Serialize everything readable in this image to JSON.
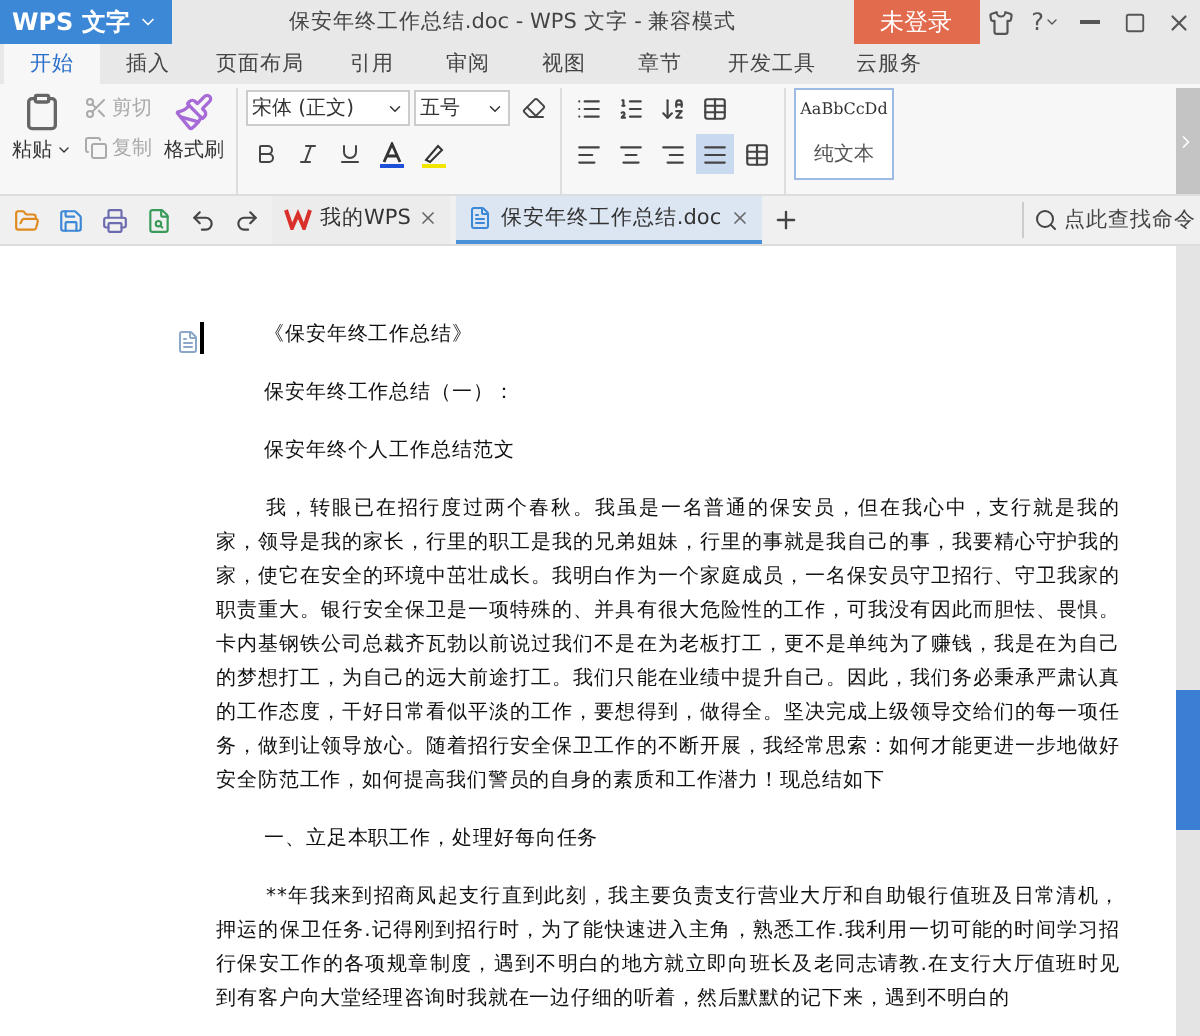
{
  "app_button": {
    "label": "WPS 文字"
  },
  "window": {
    "title": "保安年终工作总结.doc - WPS 文字 - 兼容模式"
  },
  "login_button": {
    "label": "未登录"
  },
  "help": {
    "label": "?"
  },
  "ribbon_tabs": [
    {
      "label": "开始",
      "selected": true
    },
    {
      "label": "插入",
      "selected": false
    },
    {
      "label": "页面布局",
      "selected": false
    },
    {
      "label": "引用",
      "selected": false
    },
    {
      "label": "审阅",
      "selected": false
    },
    {
      "label": "视图",
      "selected": false
    },
    {
      "label": "章节",
      "selected": false
    },
    {
      "label": "开发工具",
      "selected": false
    },
    {
      "label": "云服务",
      "selected": false
    }
  ],
  "clipboard": {
    "paste": "粘贴",
    "cut": {
      "label": "剪切",
      "disabled": true
    },
    "copy": {
      "label": "复制",
      "disabled": true
    },
    "format_painter": "格式刷"
  },
  "font": {
    "family": "宋体 (正文)",
    "size": "五号"
  },
  "alignment": [
    {
      "kind": "left",
      "selected": false
    },
    {
      "kind": "center",
      "selected": false
    },
    {
      "kind": "right",
      "selected": false
    },
    {
      "kind": "justify",
      "selected": true
    },
    {
      "kind": "distributed",
      "selected": false
    }
  ],
  "style_gallery": {
    "sample": "AaBbCcDd",
    "name": "纯文本"
  },
  "doc_tabs": [
    {
      "label": "我的WPS",
      "kind": "home",
      "selected": false
    },
    {
      "label": "保安年终工作总结.doc",
      "kind": "doc",
      "selected": true
    }
  ],
  "command_search": {
    "placeholder": "点此查找命令"
  },
  "document": {
    "paragraphs": [
      {
        "kind": "heading",
        "text": "《保安年终工作总结》"
      },
      {
        "kind": "heading",
        "text": "保安年终工作总结（一）："
      },
      {
        "kind": "heading",
        "text": "保安年终个人工作总结范文"
      },
      {
        "kind": "body",
        "text": "我，转眼已在招行度过两个春秋。我虽是一名普通的保安员，但在我心中，支行就是我的家，领导是我的家长，行里的职工是我的兄弟姐妹，行里的事就是我自己的事，我要精心守护我的家，使它在安全的环境中茁壮成长。我明白作为一个家庭成员，一名保安员守卫招行、守卫我家的职责重大。银行安全保卫是一项特殊的、并具有很大危险性的工作，可我没有因此而胆怯、畏惧。卡内基钢铁公司总裁齐瓦勃以前说过我们不是在为老板打工，更不是单纯为了赚钱，我是在为自己的梦想打工，为自己的远大前途打工。我们只能在业绩中提升自己。因此，我们务必秉承严肃认真的工作态度，干好日常看似平淡的工作，要想得到，做得全。坚决完成上级领导交给们的每一项任务，做到让领导放心。随着招行安全保卫工作的不断开展，我经常思索：如何才能更进一步地做好安全防范工作，如何提高我们警员的自身的素质和工作潜力！现总结如下"
      },
      {
        "kind": "heading",
        "text": "一、立足本职工作，处理好每向任务"
      },
      {
        "kind": "body",
        "text": "**年我来到招商凤起支行直到此刻，我主要负责支行营业大厅和自助银行值班及日常清机，押运的保卫任务.记得刚到招行时，为了能快速进入主角，熟悉工作.我利用一切可能的时间学习招行保安工作的各项规章制度，遇到不明白的地方就立即向班长及老同志请教.在支行大厅值班时见到有客户向大堂经理咨询时我就在一边仔细的听着，然后默默的记下来，遇到不明白的"
      }
    ]
  }
}
